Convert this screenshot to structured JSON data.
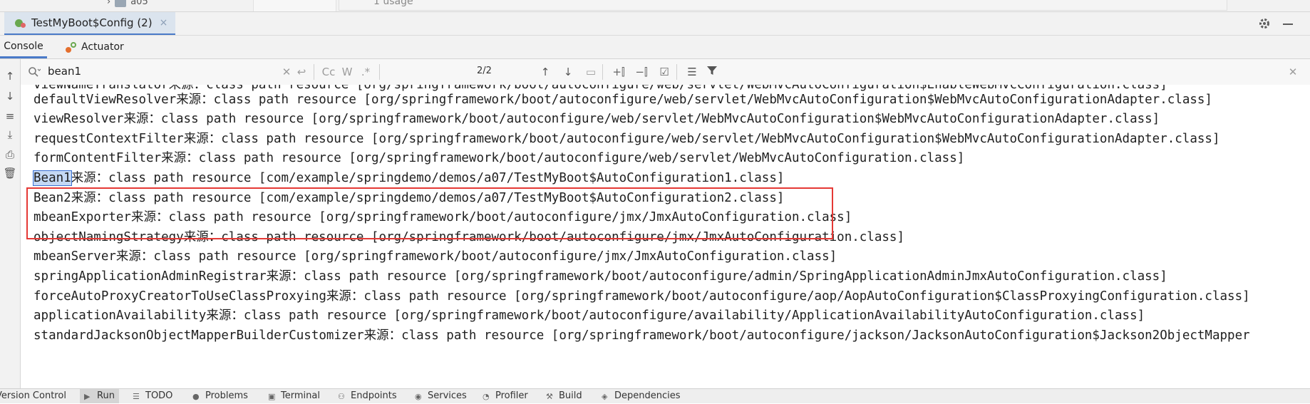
{
  "top_strip": {
    "tree_item": "a05",
    "usage_hint": "1 usage"
  },
  "run_window": {
    "tab_title": "TestMyBoot$Config (2)",
    "tab_close": "×",
    "subtabs": [
      "Console",
      "Actuator"
    ]
  },
  "search": {
    "value": "bean1",
    "match_case": "Cc",
    "words": "W",
    "regex": ".*",
    "match_count": "2/2"
  },
  "console": {
    "partial_top": "viewNameTranslator来源：class path resource [org/springframework/boot/autoconfigure/web/servlet/WebMvcAutoConfiguration$EnableWebMvcConfiguration.class]",
    "lines": [
      {
        "name": "defaultViewResolver",
        "rest": "来源：class path resource [org/springframework/boot/autoconfigure/web/servlet/WebMvcAutoConfiguration$WebMvcAutoConfigurationAdapter.class]"
      },
      {
        "name": "viewResolver",
        "rest": "来源：class path resource [org/springframework/boot/autoconfigure/web/servlet/WebMvcAutoConfiguration$WebMvcAutoConfigurationAdapter.class]"
      },
      {
        "name": "requestContextFilter",
        "rest": "来源：class path resource [org/springframework/boot/autoconfigure/web/servlet/WebMvcAutoConfiguration$WebMvcAutoConfigurationAdapter.class]"
      },
      {
        "name": "formContentFilter",
        "rest": "来源：class path resource [org/springframework/boot/autoconfigure/web/servlet/WebMvcAutoConfiguration.class]"
      },
      {
        "name": "Bean1",
        "rest": "来源：class path resource [com/example/springdemo/demos/a07/TestMyBoot$AutoConfiguration1.class]"
      },
      {
        "name": "Bean2",
        "rest": "来源：class path resource [com/example/springdemo/demos/a07/TestMyBoot$AutoConfiguration2.class]"
      },
      {
        "name": "mbeanExporter",
        "rest": "来源：class path resource [org/springframework/boot/autoconfigure/jmx/JmxAutoConfiguration.class]"
      },
      {
        "name": "objectNamingStrategy",
        "rest": "来源：class path resource [org/springframework/boot/autoconfigure/jmx/JmxAutoConfiguration.class]"
      },
      {
        "name": "mbeanServer",
        "rest": "来源：class path resource [org/springframework/boot/autoconfigure/jmx/JmxAutoConfiguration.class]"
      },
      {
        "name": "springApplicationAdminRegistrar",
        "rest": "来源：class path resource [org/springframework/boot/autoconfigure/admin/SpringApplicationAdminJmxAutoConfiguration.class]"
      },
      {
        "name": "forceAutoProxyCreatorToUseClassProxying",
        "rest": "来源：class path resource [org/springframework/boot/autoconfigure/aop/AopAutoConfiguration$ClassProxyingConfiguration.class]"
      },
      {
        "name": "applicationAvailability",
        "rest": "来源：class path resource [org/springframework/boot/autoconfigure/availability/ApplicationAvailabilityAutoConfiguration.class]"
      },
      {
        "name": "standardJacksonObjectMapperBuilderCustomizer",
        "rest": "来源：class path resource [org/springframework/boot/autoconfigure/jackson/JacksonAutoConfiguration$Jackson2ObjectMapper"
      }
    ]
  },
  "bottom_bar": [
    "Version Control",
    "Run",
    "TODO",
    "Problems",
    "Terminal",
    "Endpoints",
    "Services",
    "Profiler",
    "Build",
    "Dependencies"
  ],
  "colors": {
    "accent": "#4a7ac8",
    "highlight_box": "#e53935",
    "match_highlight": "#c4d8f4"
  }
}
